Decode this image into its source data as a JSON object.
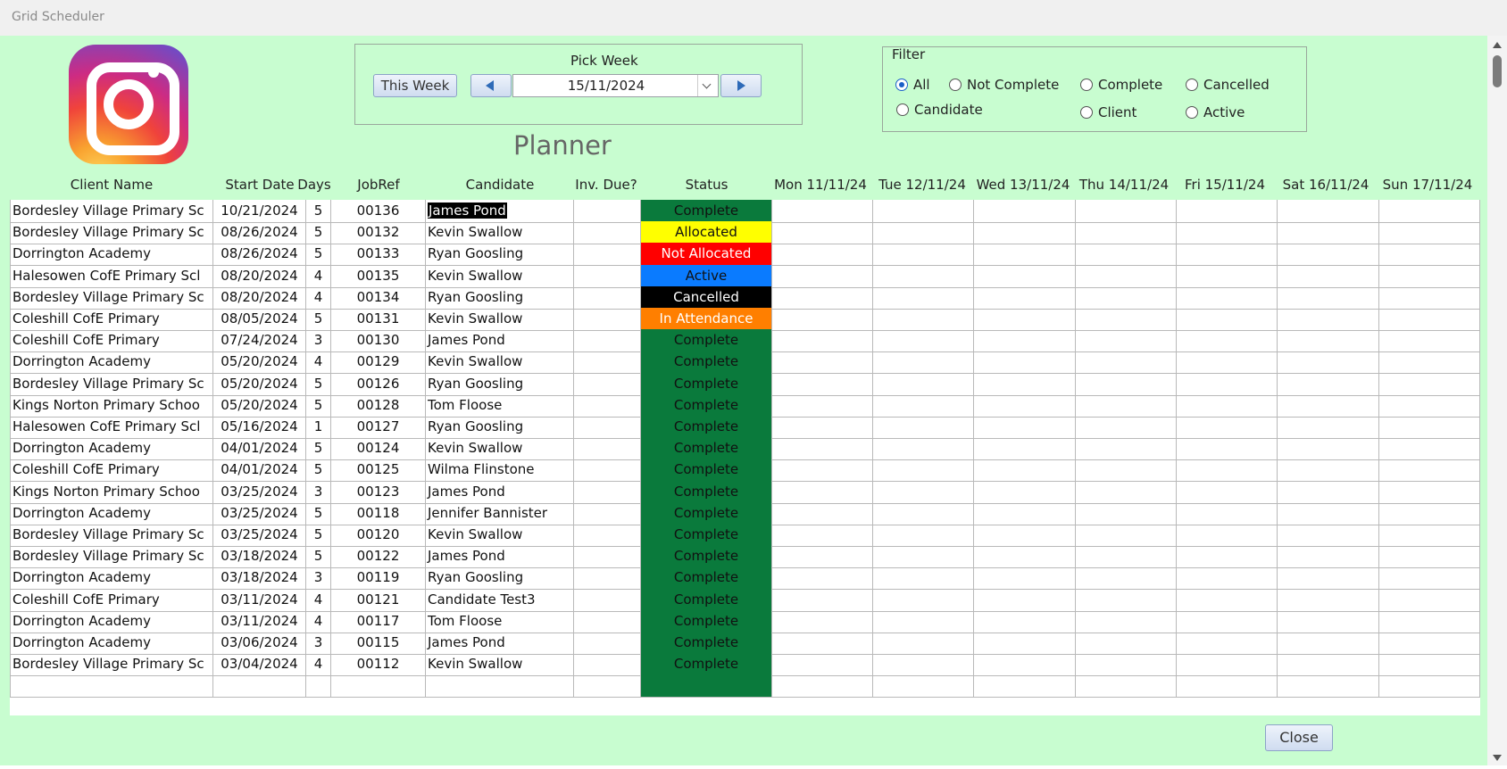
{
  "window": {
    "title": "Grid Scheduler"
  },
  "logo": {
    "icon": "instagram-icon"
  },
  "pick_week": {
    "label": "Pick Week",
    "this_week_label": "This Week",
    "date_value": "15/11/2024"
  },
  "planner_title": "Planner",
  "filter": {
    "label": "Filter",
    "options": [
      {
        "label": "All",
        "selected": true
      },
      {
        "label": "Not Complete",
        "selected": false
      },
      {
        "label": "Complete",
        "selected": false
      },
      {
        "label": "Cancelled",
        "selected": false
      },
      {
        "label": "Candidate",
        "selected": false
      },
      {
        "label": "Client",
        "selected": false
      },
      {
        "label": "Active",
        "selected": false
      }
    ]
  },
  "table": {
    "headers": [
      "Client Name",
      "Start Date",
      "Days",
      "JobRef",
      "Candidate",
      "Inv. Due?",
      "Status",
      "Mon 11/11/24",
      "Tue 12/11/24",
      "Wed 13/11/24",
      "Thu 14/11/24",
      "Fri 15/11/24",
      "Sat 16/11/24",
      "Sun 17/11/24"
    ],
    "status_colors": {
      "Complete": {
        "bg": "#0a7a3c",
        "fg": "#111111"
      },
      "Allocated": {
        "bg": "#ffff00",
        "fg": "#111111"
      },
      "Not Allocated": {
        "bg": "#ff0000",
        "fg": "#ffffff"
      },
      "Active": {
        "bg": "#0a7bff",
        "fg": "#111111"
      },
      "Cancelled": {
        "bg": "#000000",
        "fg": "#ffffff"
      },
      "In Attendance": {
        "bg": "#ff7f00",
        "fg": "#ffffff"
      }
    },
    "rows": [
      {
        "client": "Bordesley Village Primary Sc",
        "start": "10/21/2024",
        "days": "5",
        "jobref": "00136",
        "candidate": "James Pond",
        "inv": "",
        "status": "Complete",
        "selected": true
      },
      {
        "client": "Bordesley Village Primary Sc",
        "start": "08/26/2024",
        "days": "5",
        "jobref": "00132",
        "candidate": "Kevin Swallow",
        "inv": "",
        "status": "Allocated"
      },
      {
        "client": "Dorrington Academy",
        "start": "08/26/2024",
        "days": "5",
        "jobref": "00133",
        "candidate": "Ryan Goosling",
        "inv": "",
        "status": "Not Allocated"
      },
      {
        "client": "Halesowen CofE Primary Scl",
        "start": "08/20/2024",
        "days": "4",
        "jobref": "00135",
        "candidate": "Kevin Swallow",
        "inv": "",
        "status": "Active"
      },
      {
        "client": "Bordesley Village Primary Sc",
        "start": "08/20/2024",
        "days": "4",
        "jobref": "00134",
        "candidate": "Ryan Goosling",
        "inv": "",
        "status": "Cancelled"
      },
      {
        "client": "Coleshill CofE Primary",
        "start": "08/05/2024",
        "days": "5",
        "jobref": "00131",
        "candidate": "Kevin Swallow",
        "inv": "",
        "status": "In Attendance"
      },
      {
        "client": "Coleshill CofE Primary",
        "start": "07/24/2024",
        "days": "3",
        "jobref": "00130",
        "candidate": "James Pond",
        "inv": "",
        "status": "Complete"
      },
      {
        "client": "Dorrington Academy",
        "start": "05/20/2024",
        "days": "4",
        "jobref": "00129",
        "candidate": "Kevin Swallow",
        "inv": "",
        "status": "Complete"
      },
      {
        "client": "Bordesley Village Primary Sc",
        "start": "05/20/2024",
        "days": "5",
        "jobref": "00126",
        "candidate": "Ryan Goosling",
        "inv": "",
        "status": "Complete"
      },
      {
        "client": "Kings Norton Primary Schoo",
        "start": "05/20/2024",
        "days": "5",
        "jobref": "00128",
        "candidate": "Tom Floose",
        "inv": "",
        "status": "Complete"
      },
      {
        "client": "Halesowen CofE Primary Scl",
        "start": "05/16/2024",
        "days": "1",
        "jobref": "00127",
        "candidate": "Ryan Goosling",
        "inv": "",
        "status": "Complete"
      },
      {
        "client": "Dorrington Academy",
        "start": "04/01/2024",
        "days": "5",
        "jobref": "00124",
        "candidate": "Kevin Swallow",
        "inv": "",
        "status": "Complete"
      },
      {
        "client": "Coleshill CofE Primary",
        "start": "04/01/2024",
        "days": "5",
        "jobref": "00125",
        "candidate": "Wilma Flinstone",
        "inv": "",
        "status": "Complete"
      },
      {
        "client": "Kings Norton Primary Schoo",
        "start": "03/25/2024",
        "days": "3",
        "jobref": "00123",
        "candidate": "James Pond",
        "inv": "",
        "status": "Complete"
      },
      {
        "client": "Dorrington Academy",
        "start": "03/25/2024",
        "days": "5",
        "jobref": "00118",
        "candidate": "Jennifer Bannister",
        "inv": "",
        "status": "Complete"
      },
      {
        "client": "Bordesley Village Primary Sc",
        "start": "03/25/2024",
        "days": "5",
        "jobref": "00120",
        "candidate": "Kevin Swallow",
        "inv": "",
        "status": "Complete"
      },
      {
        "client": "Bordesley Village Primary Sc",
        "start": "03/18/2024",
        "days": "5",
        "jobref": "00122",
        "candidate": "James Pond",
        "inv": "",
        "status": "Complete"
      },
      {
        "client": "Dorrington Academy",
        "start": "03/18/2024",
        "days": "3",
        "jobref": "00119",
        "candidate": "Ryan Goosling",
        "inv": "",
        "status": "Complete"
      },
      {
        "client": "Coleshill CofE Primary",
        "start": "03/11/2024",
        "days": "4",
        "jobref": "00121",
        "candidate": "Candidate Test3",
        "inv": "",
        "status": "Complete"
      },
      {
        "client": "Dorrington Academy",
        "start": "03/11/2024",
        "days": "4",
        "jobref": "00117",
        "candidate": "Tom Floose",
        "inv": "",
        "status": "Complete"
      },
      {
        "client": "Dorrington Academy",
        "start": "03/06/2024",
        "days": "3",
        "jobref": "00115",
        "candidate": "James Pond",
        "inv": "",
        "status": "Complete"
      },
      {
        "client": "Bordesley Village Primary Sc",
        "start": "03/04/2024",
        "days": "4",
        "jobref": "00112",
        "candidate": "Kevin Swallow",
        "inv": "",
        "status": "Complete"
      }
    ]
  },
  "close_label": "Close"
}
